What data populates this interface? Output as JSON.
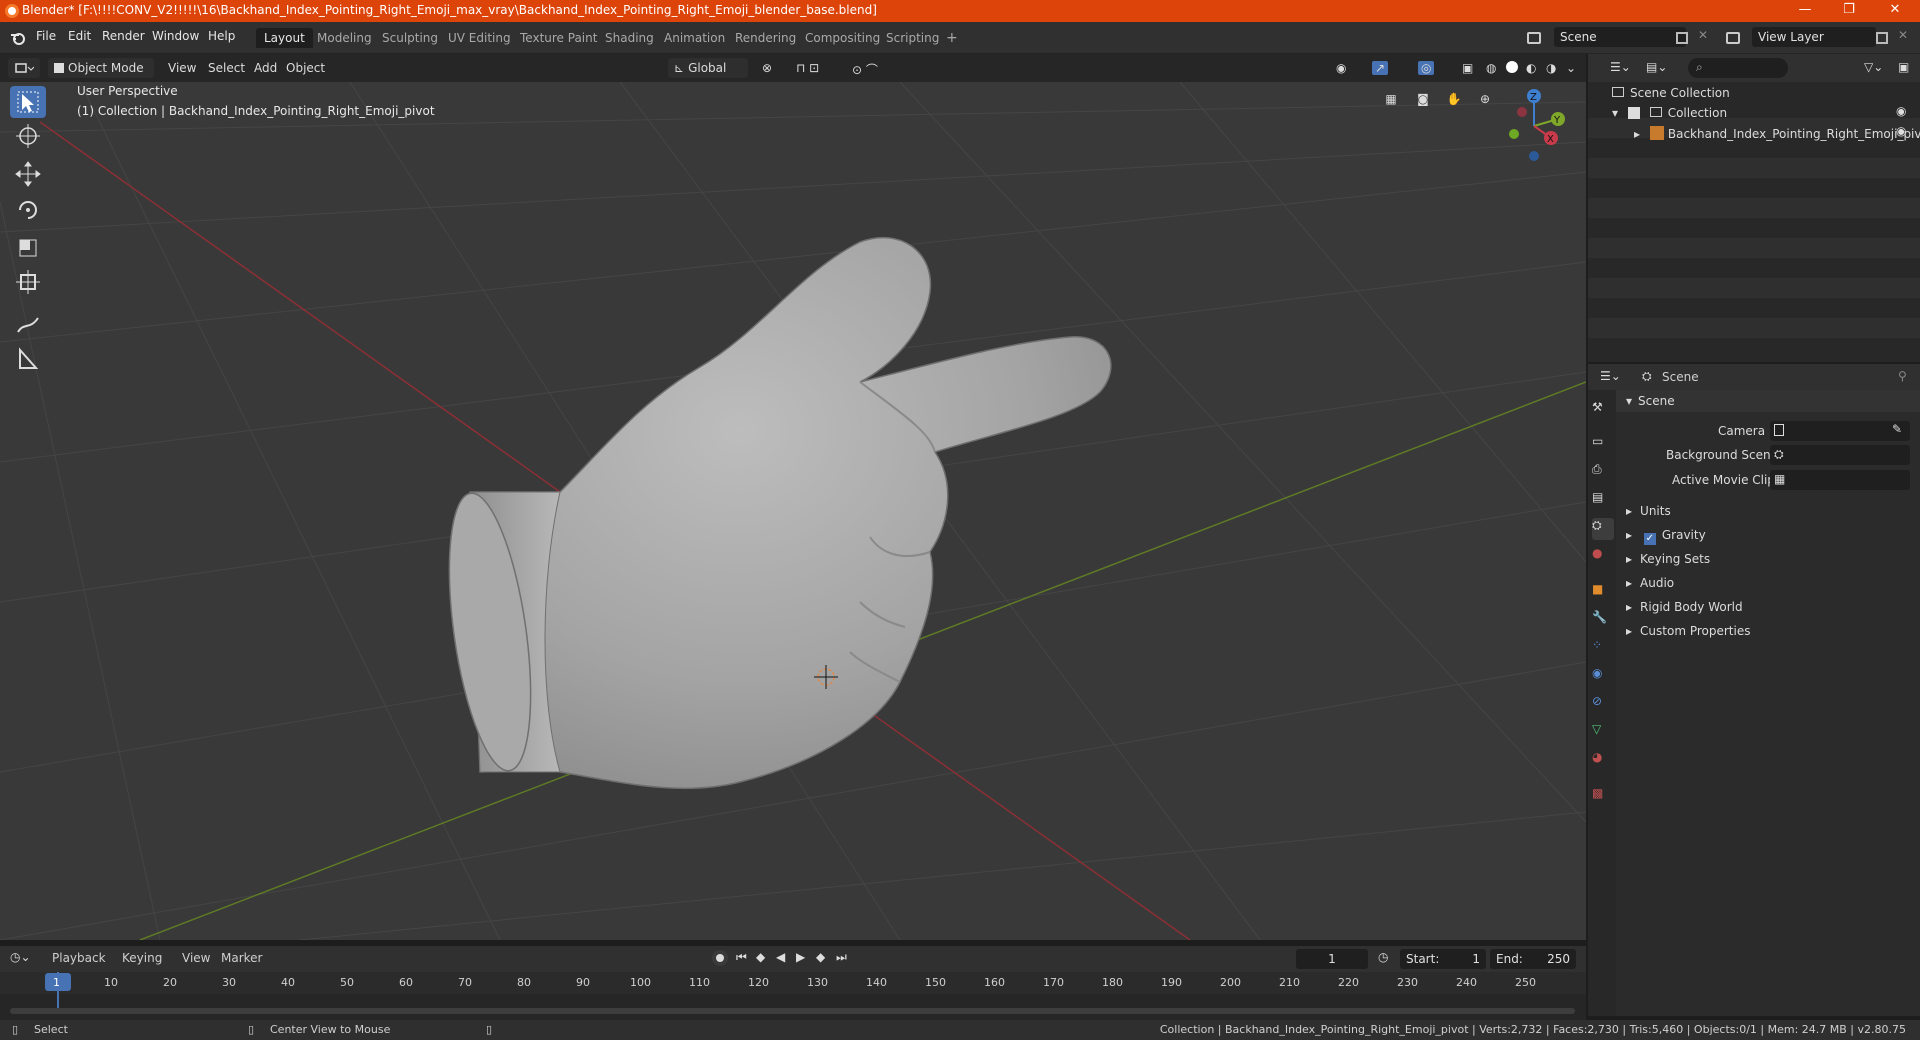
{
  "window": {
    "title": "Blender* [F:\\!!!!CONV_V2!!!!!\\16\\Backhand_Index_Pointing_Right_Emoji_max_vray\\Backhand_Index_Pointing_Right_Emoji_blender_base.blend]",
    "minimize": "—",
    "maximize": "❐",
    "close": "✕"
  },
  "menu": [
    "File",
    "Edit",
    "Render",
    "Window",
    "Help"
  ],
  "workspaces": [
    "Layout",
    "Modeling",
    "Sculpting",
    "UV Editing",
    "Texture Paint",
    "Shading",
    "Animation",
    "Rendering",
    "Compositing",
    "Scripting"
  ],
  "scene_field": "Scene",
  "view_layer_field": "View Layer",
  "viewport_header": {
    "mode": "Object Mode",
    "menus": [
      "View",
      "Select",
      "Add",
      "Object"
    ],
    "transform": "Global"
  },
  "viewport": {
    "perspective": "User Perspective",
    "collection_info": "(1) Collection | Backhand_Index_Pointing_Right_Emoji_pivot"
  },
  "outliner": {
    "root": "Scene Collection",
    "collection": "Collection",
    "object": "Backhand_Index_Pointing_Right_Emoji_pivot"
  },
  "properties": {
    "header": "Scene",
    "panel": "Scene",
    "camera_label": "Camera",
    "bg_scene_label": "Background Scene",
    "movie_clip_label": "Active Movie Clip",
    "sections": [
      "Units",
      "Gravity",
      "Keying Sets",
      "Audio",
      "Rigid Body World",
      "Custom Properties"
    ]
  },
  "timeline": {
    "menus": [
      "Playback",
      "Keying",
      "View",
      "Marker"
    ],
    "current_frame": "1",
    "start_label": "Start:",
    "start": "1",
    "end_label": "End:",
    "end": "250",
    "ticks": [
      "1",
      "10",
      "20",
      "30",
      "40",
      "50",
      "60",
      "70",
      "80",
      "90",
      "100",
      "110",
      "120",
      "130",
      "140",
      "150",
      "160",
      "170",
      "180",
      "190",
      "200",
      "210",
      "220",
      "230",
      "240",
      "250"
    ]
  },
  "status": {
    "select": "Select",
    "center": "Center View to Mouse",
    "info": "Collection | Backhand_Index_Pointing_Right_Emoji_pivot | Verts:2,732 | Faces:2,730 | Tris:5,460 | Objects:0/1 | Mem: 24.7 MB | v2.80.75"
  }
}
